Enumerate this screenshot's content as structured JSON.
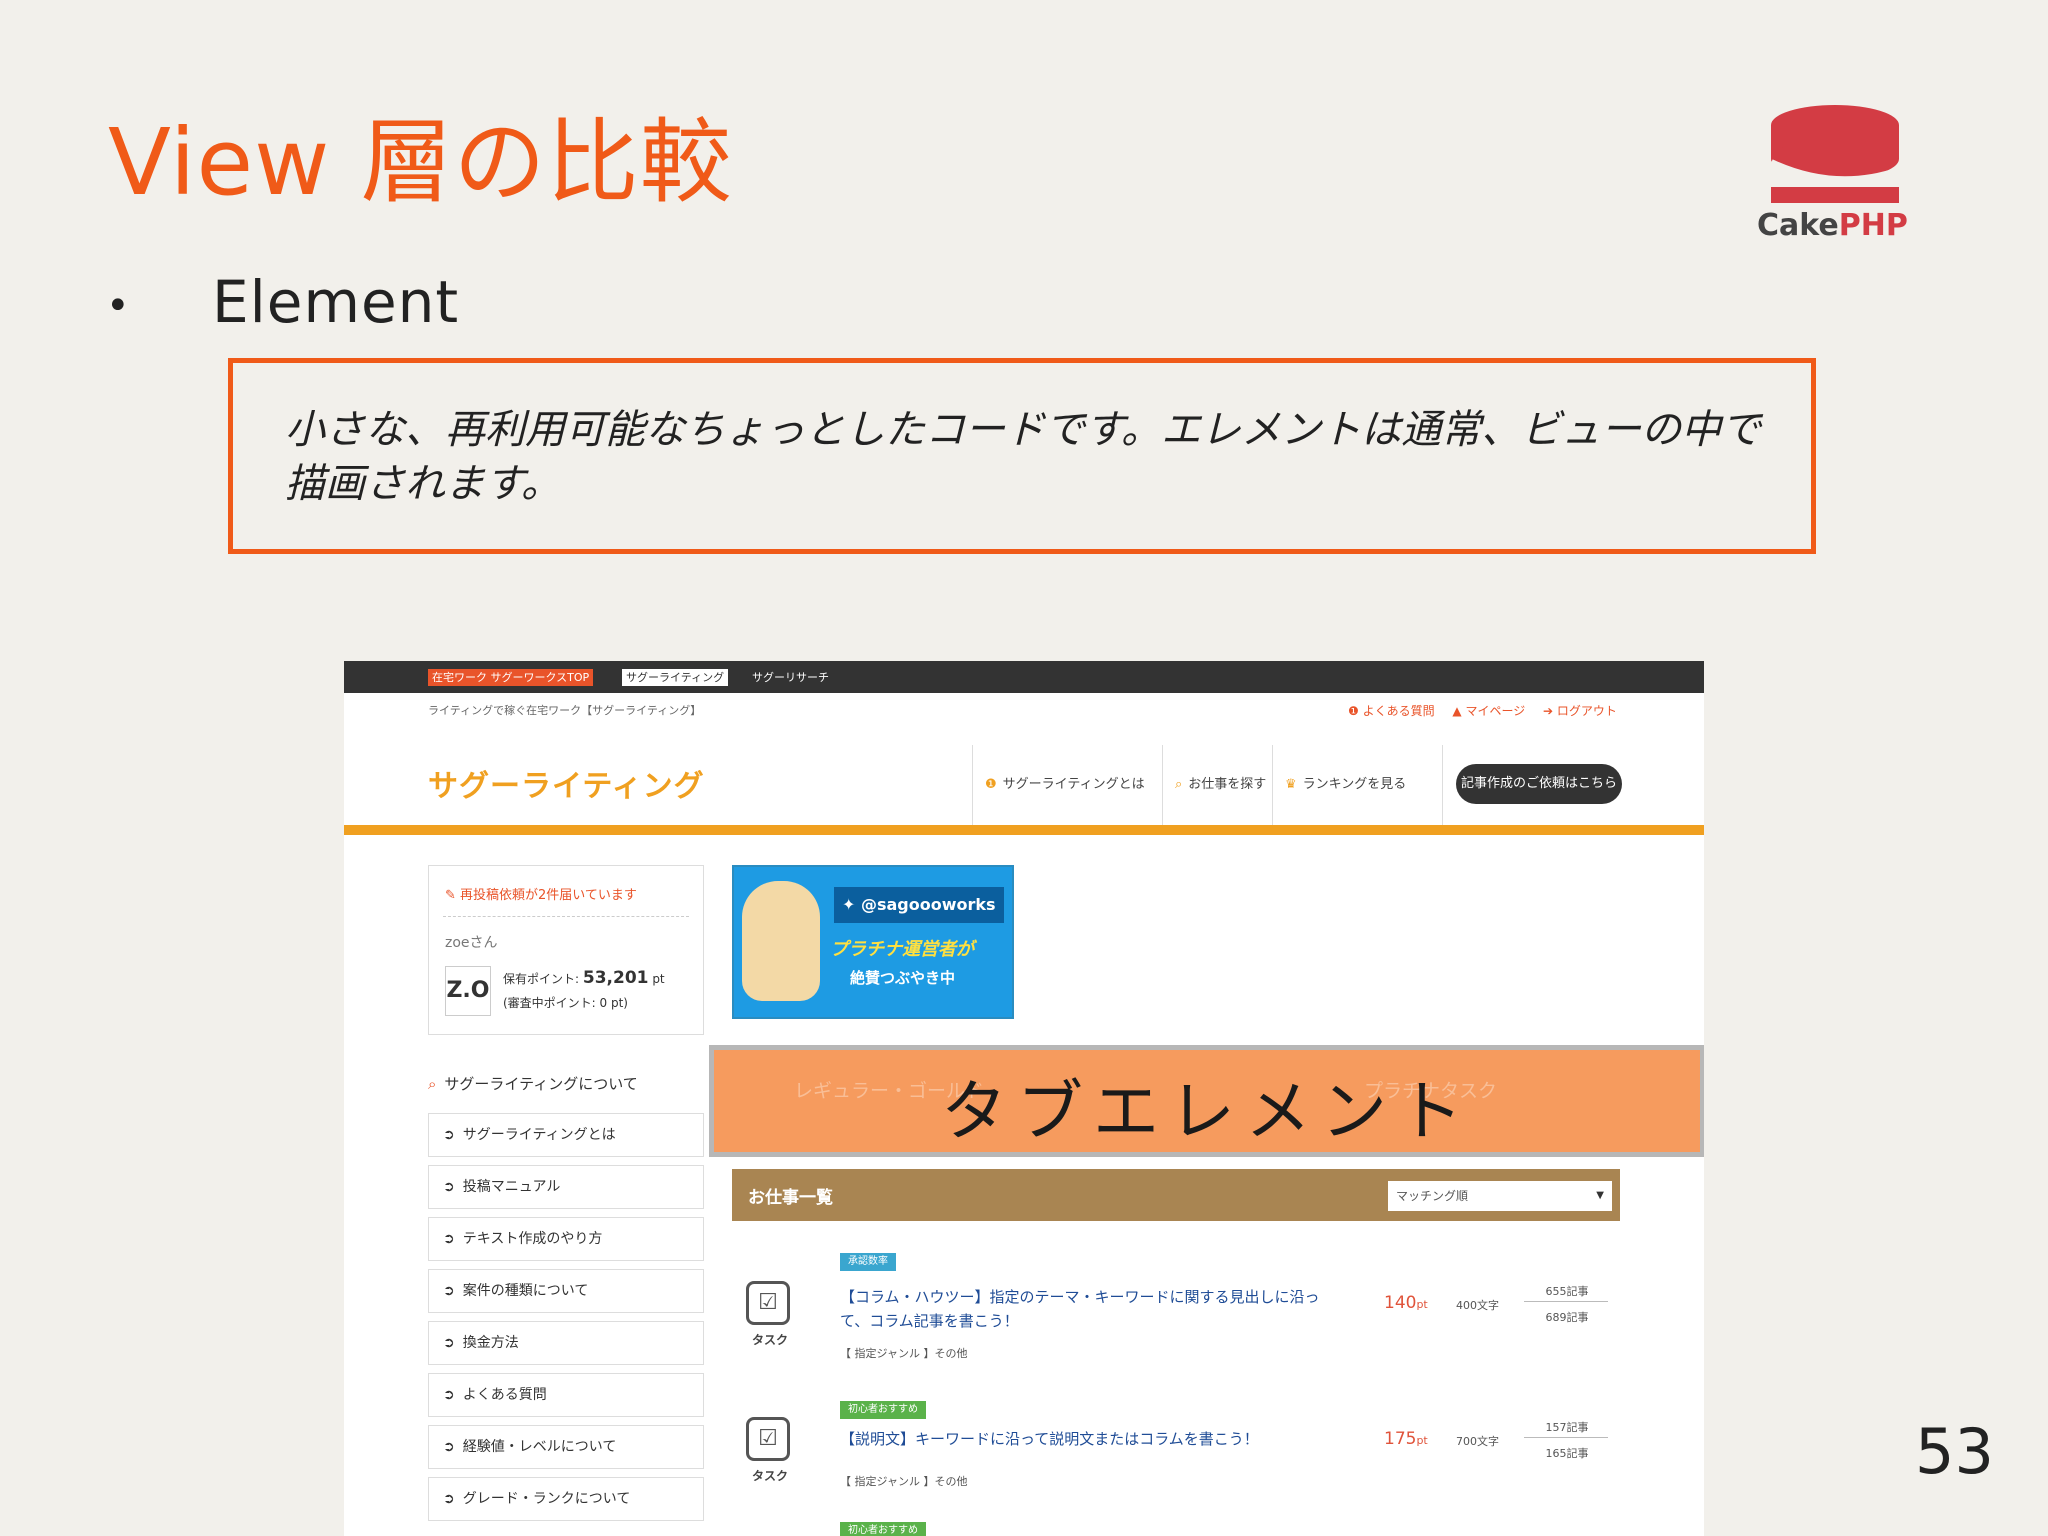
{
  "slide": {
    "title": "View 層の比較",
    "bullet": "•",
    "bullet_text": "Element",
    "callout": "小さな、再利用可能なちょっとしたコードです。エレメントは通常、ビューの中で描画されます。",
    "page_number": "53",
    "logo_word_cake": "Cake",
    "logo_word_php": "PHP",
    "colors": {
      "accent": "#f05a18",
      "background": "#f2f0eb",
      "logo_red": "#d33c44"
    }
  },
  "screenshot": {
    "topbar": {
      "link_1": "在宅ワーク サグーワークスTOP",
      "link_2": "サグーライティング",
      "link_3": "サグーリサーチ"
    },
    "subline": "ライティングで稼ぐ在宅ワーク【サグーライティング】",
    "sublinks": [
      "❶ よくある質問",
      "▲ マイページ",
      "➔ ログアウト"
    ],
    "site_logo": "サグーライティング",
    "nav": [
      {
        "icon": "❶",
        "label": "サグーライティングとは"
      },
      {
        "icon": "⌕",
        "label": "お仕事を探す"
      },
      {
        "icon": "♛",
        "label": "ランキングを見る"
      }
    ],
    "nav_cta": "記事作成のご依頼はこちら",
    "user": {
      "notice": "再投稿依頼が2件届いています",
      "name": "zoeさん",
      "avatar": "Z.O",
      "points_label": "保有ポイント:",
      "points_value": "53,201",
      "points_unit": "pt",
      "pending_points": "(審査中ポイント: 0 pt)"
    },
    "banner": {
      "handle": "@sagoooworks",
      "line_1": "プラチナ運営者が",
      "line_2": "絶賛つぶやき中"
    },
    "sidebar": {
      "heading": "サグーライティングについて",
      "items": [
        "サグーライティングとは",
        "投稿マニュアル",
        "テキスト作成のやり方",
        "案件の種類について",
        "換金方法",
        "よくある質問",
        "経験値・レベルについて",
        "グレード・ランクについて"
      ]
    },
    "tab_overlay": {
      "label": "タブエレメント",
      "ghost_left": "レギュラー・ゴールド",
      "ghost_right": "プラチナタスク"
    },
    "job_list": {
      "title": "お仕事一覧",
      "sort_value": "マッチング順",
      "tasks": [
        {
          "tag": "承認数率",
          "tag_color": "#3aa6cf",
          "icon_label": "タスク",
          "title": "【コラム・ハウツー】指定のテーマ・キーワードに関する見出しに沿って、コラム記事を書こう！",
          "meta": "【 指定ジャンル 】その他",
          "points": "140",
          "points_unit": "pt",
          "chars": "400文字",
          "count_top": "655記事",
          "count_bottom": "689記事"
        },
        {
          "tag": "初心者おすすめ",
          "tag_color": "#5ab24a",
          "icon_label": "タスク",
          "title": "【説明文】キーワードに沿って説明文またはコラムを書こう！",
          "meta": "【 指定ジャンル 】その他",
          "points": "175",
          "points_unit": "pt",
          "chars": "700文字",
          "count_top": "157記事",
          "count_bottom": "165記事"
        }
      ],
      "next_tag": "初心者おすすめ"
    }
  }
}
